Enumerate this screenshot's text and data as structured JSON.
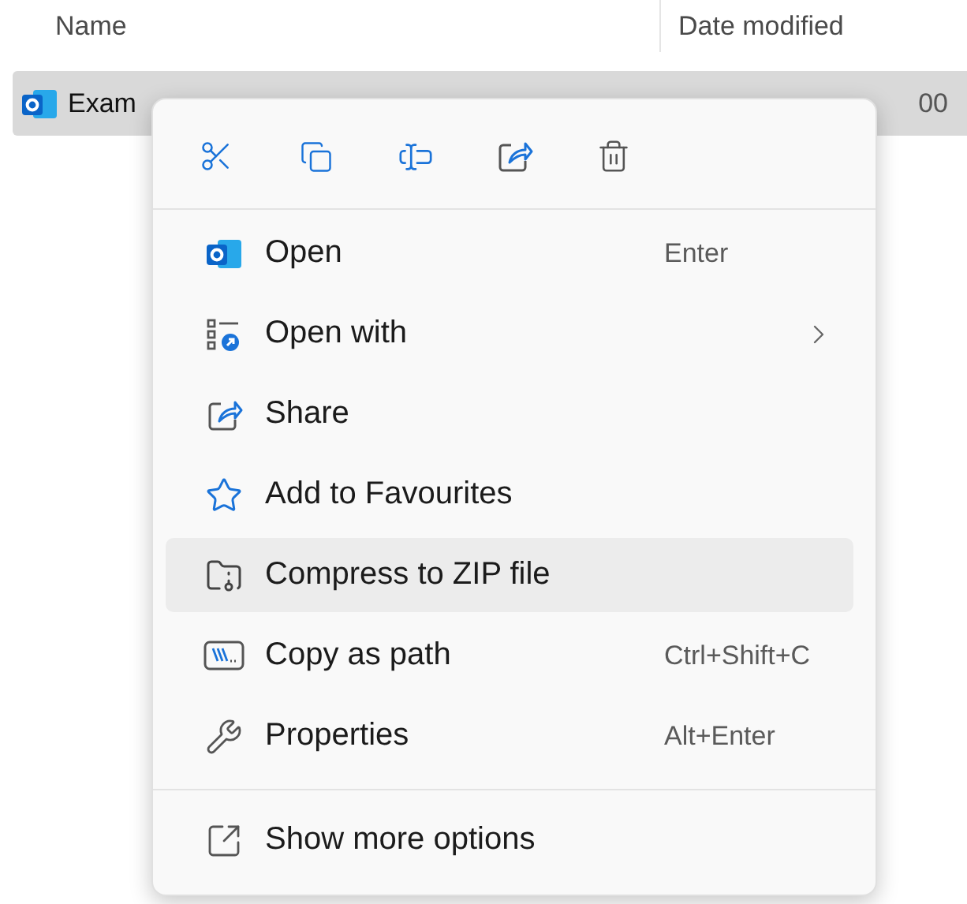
{
  "columns": [
    {
      "label": "Name"
    },
    {
      "label": "Date modified"
    }
  ],
  "file": {
    "name": "Exam",
    "date": "00",
    "selected": true
  },
  "menu": {
    "items": [
      {
        "label": "Open",
        "shortcut": "Enter",
        "has_submenu": false,
        "highlighted": false
      },
      {
        "label": "Open with",
        "has_submenu": true,
        "highlighted": false
      },
      {
        "label": "Share",
        "has_submenu": false,
        "highlighted": false
      },
      {
        "label": "Add to Favourites",
        "has_submenu": false,
        "highlighted": false
      },
      {
        "label": "Compress to ZIP file",
        "has_submenu": false,
        "highlighted": true
      },
      {
        "label": "Copy as path",
        "shortcut": "Ctrl+Shift+C",
        "has_submenu": false,
        "highlighted": false
      },
      {
        "label": "Properties",
        "shortcut": "Alt+Enter",
        "has_submenu": false,
        "highlighted": false
      }
    ],
    "footer": [
      {
        "label": "Show more options",
        "highlighted": false
      }
    ]
  }
}
